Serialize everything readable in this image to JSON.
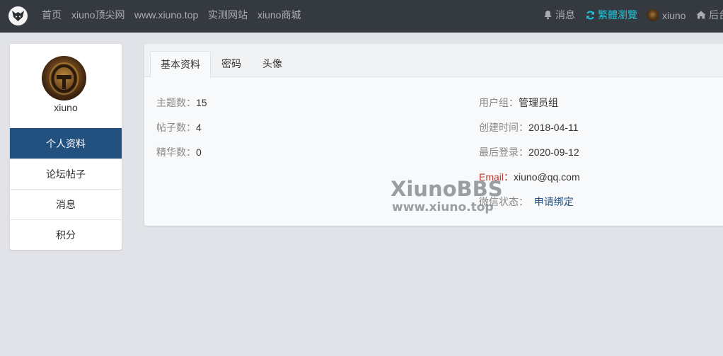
{
  "nav": {
    "links": [
      "首页",
      "xiuno顶尖网",
      "www.xiuno.top",
      "实测网站",
      "xiuno商城"
    ],
    "right": {
      "messages": "消息",
      "traditional": "繁體瀏覽",
      "username": "xiuno",
      "admin": "后台"
    },
    "icons": {
      "logo": "xiuno-logo",
      "messages": "bell-icon",
      "traditional": "refresh-icon",
      "admin": "home-icon"
    },
    "colors": {
      "background": "#343a40",
      "link": "#a9adb3",
      "accent": "#17c7dd"
    }
  },
  "sidebar": {
    "username": "xiuno",
    "menu": [
      {
        "label": "个人资料",
        "active": true
      },
      {
        "label": "论坛帖子",
        "active": false
      },
      {
        "label": "消息",
        "active": false
      },
      {
        "label": "积分",
        "active": false
      }
    ],
    "colors": {
      "active_bg": "#22507f"
    }
  },
  "tabs": [
    {
      "label": "基本资料",
      "active": true
    },
    {
      "label": "密码",
      "active": false
    },
    {
      "label": "头像",
      "active": false
    }
  ],
  "profile": {
    "left": [
      {
        "label": "主题数：",
        "value": "15"
      },
      {
        "label": "帖子数：",
        "value": "4"
      },
      {
        "label": "精华数：",
        "value": "0"
      }
    ],
    "right": [
      {
        "label": "用户组：",
        "value": "管理员组"
      },
      {
        "label": "创建时间：",
        "value": "2018-04-11"
      },
      {
        "label": "最后登录：",
        "value": "2020-09-12"
      },
      {
        "label": "Email：",
        "value": "xiuno@qq.com"
      },
      {
        "label": "微信状态：",
        "value": "申请绑定"
      }
    ]
  },
  "watermark": {
    "line1": "XiunoBBS",
    "line2": "www.xiuno.top"
  }
}
